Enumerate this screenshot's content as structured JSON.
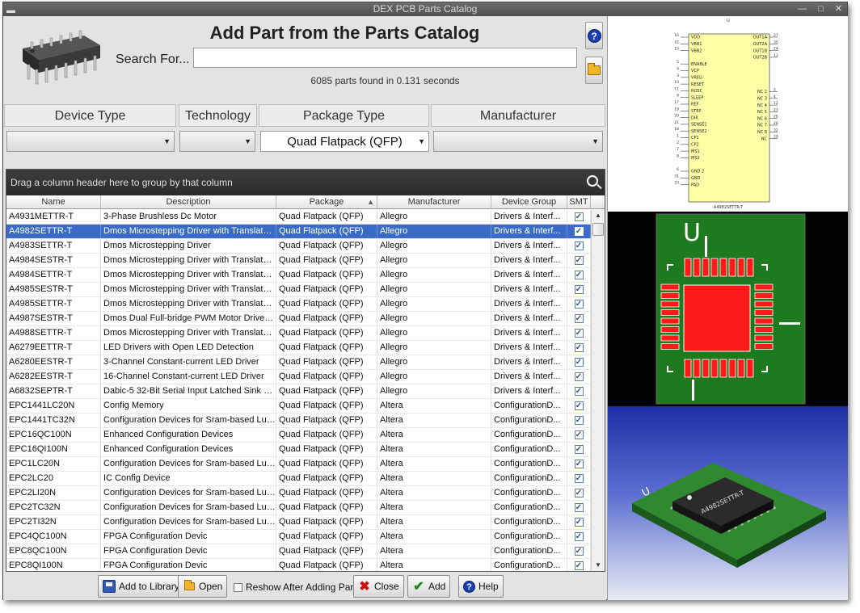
{
  "window": {
    "title": "DEX PCB Parts Catalog"
  },
  "header": {
    "title": "Add Part from the Parts Catalog",
    "search_label": "Search For...",
    "search_value": "",
    "status": "6085 parts found in 0.131 seconds"
  },
  "filters": {
    "device_type": {
      "label": "Device Type",
      "value": ""
    },
    "technology": {
      "label": "Technology",
      "value": ""
    },
    "package_type": {
      "label": "Package Type",
      "value": "Quad Flatpack (QFP)"
    },
    "manufacturer": {
      "label": "Manufacturer",
      "value": ""
    }
  },
  "grid": {
    "group_hint": "Drag a column header here to group by that column",
    "columns": [
      "Name",
      "Description",
      "Package",
      "Manufacturer",
      "Device Group",
      "SMT"
    ],
    "selected_index": 1,
    "rows": [
      [
        "A4931METTR-T",
        "3-Phase Brushless Dc Motor",
        "Quad Flatpack (QFP)",
        "Allegro",
        "Drivers & Interf..."
      ],
      [
        "A4982SETTR-T",
        "Dmos Microstepping Driver with Translator ...",
        "Quad Flatpack (QFP)",
        "Allegro",
        "Drivers & Interf..."
      ],
      [
        "A4983SETTR-T",
        "Dmos Microstepping Driver",
        "Quad Flatpack (QFP)",
        "Allegro",
        "Drivers & Interf..."
      ],
      [
        "A4984SESTR-T",
        "Dmos Microstepping Driver with Translator...",
        "Quad Flatpack (QFP)",
        "Allegro",
        "Drivers & Interf..."
      ],
      [
        "A4984SETTR-T",
        "Dmos Microstepping Driver with Translator...",
        "Quad Flatpack (QFP)",
        "Allegro",
        "Drivers & Interf..."
      ],
      [
        "A4985SESTR-T",
        "Dmos Microstepping Driver with Translator...",
        "Quad Flatpack (QFP)",
        "Allegro",
        "Drivers & Interf..."
      ],
      [
        "A4985SETTR-T",
        "Dmos Microstepping Driver with Translator...",
        "Quad Flatpack (QFP)",
        "Allegro",
        "Drivers & Interf..."
      ],
      [
        "A4987SESTR-T",
        "Dmos Dual Full-bridge PWM Motor Driver ...",
        "Quad Flatpack (QFP)",
        "Allegro",
        "Drivers & Interf..."
      ],
      [
        "A4988SETTR-T",
        "Dmos Microstepping Driver with Translator...",
        "Quad Flatpack (QFP)",
        "Allegro",
        "Drivers & Interf..."
      ],
      [
        "A6279EETTR-T",
        "LED Drivers with Open LED Detection",
        "Quad Flatpack (QFP)",
        "Allegro",
        "Drivers & Interf..."
      ],
      [
        "A6280EESTR-T",
        "3-Channel Constant-current LED Driver",
        "Quad Flatpack (QFP)",
        "Allegro",
        "Drivers & Interf..."
      ],
      [
        "A6282EESTR-T",
        "16-Channel Constant-current LED Driver",
        "Quad Flatpack (QFP)",
        "Allegro",
        "Drivers & Interf..."
      ],
      [
        "A6832SEPTR-T",
        "Dabic-5 32-Bit Serial Input Latched Sink Dr...",
        "Quad Flatpack (QFP)",
        "Allegro",
        "Drivers & Interf..."
      ],
      [
        "EPC1441LC20N",
        "Config Memory",
        "Quad Flatpack (QFP)",
        "Altera",
        "ConfigurationD..."
      ],
      [
        "EPC1441TC32N",
        "Configuration Devices for Sram-based Lut...",
        "Quad Flatpack (QFP)",
        "Altera",
        "ConfigurationD..."
      ],
      [
        "EPC16QC100N",
        "Enhanced Configuration Devices",
        "Quad Flatpack (QFP)",
        "Altera",
        "ConfigurationD..."
      ],
      [
        "EPC16QI100N",
        "Enhanced Configuration Devices",
        "Quad Flatpack (QFP)",
        "Altera",
        "ConfigurationD..."
      ],
      [
        "EPC1LC20N",
        "Configuration Devices for Sram-based Lut...",
        "Quad Flatpack (QFP)",
        "Altera",
        "ConfigurationD..."
      ],
      [
        "EPC2LC20",
        "IC Config Device",
        "Quad Flatpack (QFP)",
        "Altera",
        "ConfigurationD..."
      ],
      [
        "EPC2LI20N",
        "Configuration Devices for Sram-based Lut...",
        "Quad Flatpack (QFP)",
        "Altera",
        "ConfigurationD..."
      ],
      [
        "EPC2TC32N",
        "Configuration Devices for Sram-based Lut...",
        "Quad Flatpack (QFP)",
        "Altera",
        "ConfigurationD..."
      ],
      [
        "EPC2TI32N",
        "Configuration Devices for Sram-based Lut...",
        "Quad Flatpack (QFP)",
        "Altera",
        "ConfigurationD..."
      ],
      [
        "EPC4QC100N",
        "FPGA Configuration Devic",
        "Quad Flatpack (QFP)",
        "Altera",
        "ConfigurationD..."
      ],
      [
        "EPC8QC100N",
        "FPGA Configuration Devic",
        "Quad Flatpack (QFP)",
        "Altera",
        "ConfigurationD..."
      ],
      [
        "EPC8QI100N",
        "FPGA Configuration Devic",
        "Quad Flatpack (QFP)",
        "Altera",
        "ConfigurationD..."
      ]
    ]
  },
  "buttons": {
    "add_to_library": "Add to Library",
    "open": "Open",
    "reshow": "Reshow After Adding Part",
    "close": "Close",
    "add": "Add",
    "help": "Help"
  },
  "schematic": {
    "ref": "U",
    "part": "A4982SETTR-T",
    "left_pins": [
      [
        "16",
        "VDD"
      ],
      [
        "22",
        "VBB1"
      ],
      [
        "15",
        "VBB2"
      ],
      [
        "",
        ""
      ],
      [
        "5",
        "ENABLE"
      ],
      [
        "4",
        "VCP"
      ],
      [
        "3",
        "VREG"
      ],
      [
        "10",
        "RESET"
      ],
      [
        "11",
        "ROSC"
      ],
      [
        "9",
        "SLEEP"
      ],
      [
        "17",
        "REF"
      ],
      [
        "19",
        "STEP"
      ],
      [
        "20",
        "DIR"
      ],
      [
        "21",
        "SENSE1"
      ],
      [
        "18",
        "SENSE2"
      ],
      [
        "1",
        "CP1"
      ],
      [
        "2",
        "CP2"
      ],
      [
        "7",
        "MS1"
      ],
      [
        "8",
        "MS2"
      ],
      [
        "",
        ""
      ],
      [
        "6",
        "GND 2"
      ],
      [
        "31",
        "GND"
      ],
      [
        "33",
        "PAD"
      ]
    ],
    "right_pins": [
      [
        "27",
        "OUT1A"
      ],
      [
        "30",
        "OUT2A"
      ],
      [
        "24",
        "OUT1B"
      ],
      [
        "13",
        "OUT2B"
      ],
      [
        "",
        ""
      ],
      [
        "2",
        "NC 2"
      ],
      [
        "4",
        "NC 3"
      ],
      [
        "12",
        "NC 4"
      ],
      [
        "23",
        "NC 5"
      ],
      [
        "26",
        "NC 6"
      ],
      [
        "28",
        "NC 7"
      ],
      [
        "32",
        "NC 8"
      ],
      [
        "29",
        "NC"
      ]
    ]
  },
  "pcb": {
    "ref": "U"
  },
  "model3d": {
    "marking": "A4982SETTR-T",
    "ref": "U"
  },
  "colors": {
    "selection": "#3a6bc8",
    "pcb_board": "#1e7a1e",
    "pad": "#ff1a1a",
    "schem_body": "#ffffa8"
  }
}
